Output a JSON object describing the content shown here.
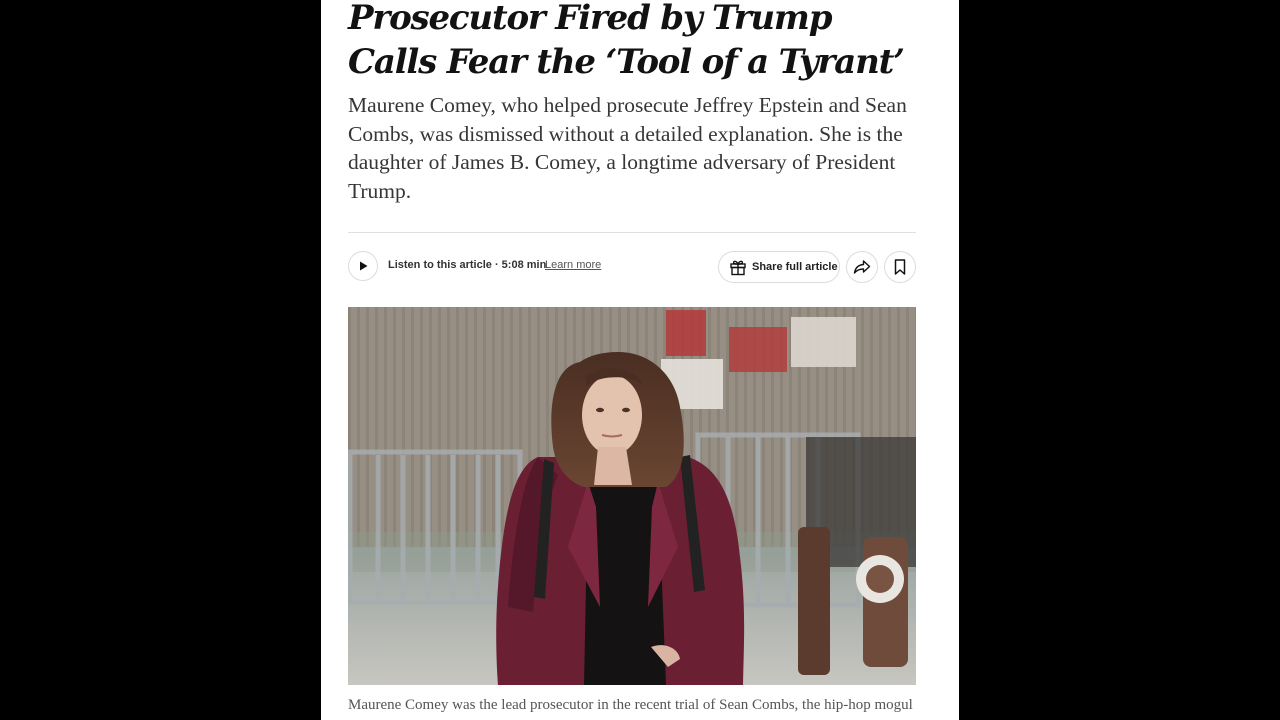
{
  "article": {
    "headline": "Prosecutor Fired by Trump Calls Fear the ‘Tool of a Tyrant’",
    "summary": "Maurene Comey, who helped prosecute Jeffrey Epstein and Sean Combs, was dismissed without a detailed explanation. She is the daughter of James B. Comey, a longtime adversary of President Trump.",
    "caption": "Maurene Comey was the lead prosecutor in the recent trial of Sean Combs, the hip-hop mogul who was acquitted of the most serious charges against him."
  },
  "toolbar": {
    "play_icon": "play-icon",
    "listen_label": "Listen to this article · 5:08 min",
    "learn_more": "Learn more",
    "share_full_label": "Share full article",
    "gift_icon": "gift-icon",
    "share_icon": "share-arrow-icon",
    "bookmark_icon": "bookmark-icon"
  },
  "colors": {
    "background": "#000000",
    "page": "#ffffff",
    "headline": "#121212",
    "coat": "#6b1f33"
  }
}
